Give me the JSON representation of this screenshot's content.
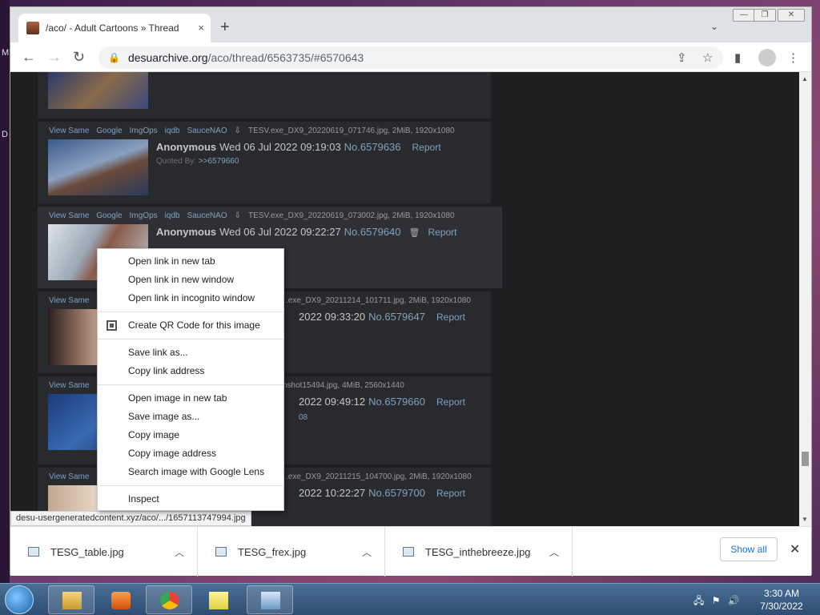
{
  "desktop": {
    "left_letters": [
      "M",
      "D"
    ]
  },
  "browser": {
    "tab_title": "/aco/ - Adult Cartoons » Thread",
    "tab_close": "×",
    "new_tab": "+",
    "tab_search": "⌄",
    "window_controls": [
      "—",
      "❐",
      "✕"
    ],
    "url_host": "desuarchive.org",
    "url_path": "/aco/thread/6563735/#6570643",
    "status_url": "desu-usergeneratedcontent.xyz/aco/.../1657113747994.jpg"
  },
  "posts": [
    {
      "links": [
        "View Same",
        "Google",
        "ImgOps",
        "iqdb",
        "SauceNAO"
      ],
      "filename": "TESV.exe_DX9_20220619_071746.jpg, 2MiB, 1920x1080",
      "name": "Anonymous",
      "date": "Wed 06 Jul 2022 09:19:03",
      "number": "No.6579636",
      "report": "Report",
      "quoted_label": "Quoted By:",
      "quoted_link": ">>6579660"
    },
    {
      "links": [
        "View Same",
        "Google",
        "ImgOps",
        "iqdb",
        "SauceNAO"
      ],
      "filename": "TESV.exe_DX9_20220619_073002.jpg, 2MiB, 1920x1080",
      "name": "Anonymous",
      "date": "Wed 06 Jul 2022 09:22:27",
      "number": "No.6579640",
      "report": "Report"
    },
    {
      "links": [
        "View Same"
      ],
      "filename_tail": ".exe_DX9_20211214_101711.jpg, 2MiB, 1920x1080",
      "date_tail": "2022 09:33:20",
      "number": "No.6579647",
      "report": "Report"
    },
    {
      "links": [
        "View Same"
      ],
      "filename_tail": "nshot15494.jpg, 4MiB, 2560x1440",
      "date_tail": "2022 09:49:12",
      "number": "No.6579660",
      "report": "Report",
      "quote_tail": "08"
    },
    {
      "links": [
        "View Same"
      ],
      "filename_tail": ".exe_DX9_20211215_104700.jpg, 2MiB, 1920x1080",
      "date_tail": "2022 10:22:27",
      "number": "No.6579700",
      "report": "Report"
    }
  ],
  "context_menu": {
    "group1": [
      "Open link in new tab",
      "Open link in new window",
      "Open link in incognito window"
    ],
    "qr": "Create QR Code for this image",
    "group2": [
      "Save link as...",
      "Copy link address"
    ],
    "group3": [
      "Open image in new tab",
      "Save image as...",
      "Copy image",
      "Copy image address",
      "Search image with Google Lens"
    ],
    "inspect": "Inspect"
  },
  "downloads": {
    "items": [
      "TESG_table.jpg",
      "TESG_frex.jpg",
      "TESG_inthebreeze.jpg"
    ],
    "show_all": "Show all",
    "close": "✕"
  },
  "taskbar": {
    "time": "3:30 AM",
    "date": "7/30/2022"
  }
}
